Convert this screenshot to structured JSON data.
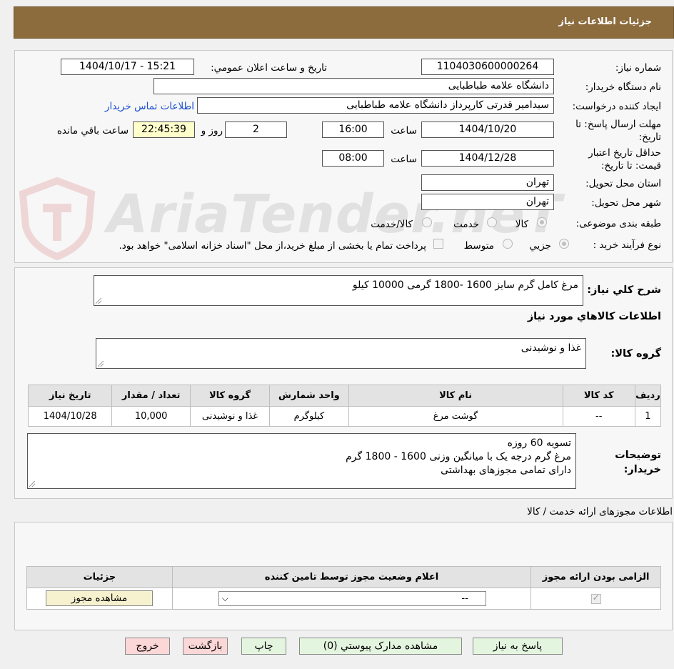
{
  "header": {
    "title": "جزئیات اطلاعات نیاز"
  },
  "form": {
    "need_number_label": "شماره نیاز:",
    "need_number": "1104030600000264",
    "announce_label": "تاریخ و ساعت اعلان عمومي:",
    "announce_value": "1404/10/17 - 15:21",
    "buyer_org_label": "نام دستگاه خريدار:",
    "buyer_org": "دانشگاه علامه طباطبایی",
    "requester_label": "ايجاد کننده درخواست:",
    "requester": "سیدامیر قدرتی کارپرداز دانشگاه علامه طباطبایی",
    "contact_link": "اطلاعات تماس خريدار",
    "deadline_label": "مهلت ارسال پاسخ: تا تاریخ:",
    "deadline_date": "1404/10/20",
    "time_label": "ساعت",
    "deadline_time": "16:00",
    "days_value": "2",
    "days_suffix": "روز و",
    "remaining_time": "22:45:39",
    "remaining_label": "ساعت باقي مانده",
    "price_validity_label": "حداقل تاريخ اعتبار قيمت: تا تاريخ:",
    "price_validity_date": "1404/12/28",
    "price_validity_time": "08:00",
    "province_label": "استان محل تحويل:",
    "province": "تهران",
    "city_label": "شهر محل تحويل:",
    "city": "تهران",
    "category_label": "طبقه بندی موضوعی:",
    "category_options": [
      "کالا",
      "خدمت",
      "کالا/خدمت"
    ],
    "process_label": "نوع فرآيند خريد :",
    "process_options": [
      "جزيي",
      "متوسط"
    ],
    "payment_note": "پرداخت تمام يا بخشی از مبلغ خريد،از محل \"اسناد خزانه اسلامی\" خواهد بود."
  },
  "summary": {
    "label": "شرح کلي نياز:",
    "text": "مرغ کامل گرم سایز 1600 -1800 گرمی 10000 کیلو",
    "goods_info_title": "اطلاعات کالاهاي مورد نياز",
    "goods_group_label": "گروه کالا:",
    "goods_group": "غذا و نوشیدنی"
  },
  "items_table": {
    "headers": [
      "رديف",
      "کد کالا",
      "نام کالا",
      "واحد شمارش",
      "گروه کالا",
      "تعداد / مقدار",
      "تاريخ نياز"
    ],
    "rows": [
      [
        "1",
        "--",
        "گوشت مرغ",
        "کیلوگرم",
        "غذا و نوشیدنی",
        "10,000",
        "1404/10/28"
      ]
    ]
  },
  "buyer_notes": {
    "label": "توضيحات خريدار:",
    "lines": [
      "تسویه 60 روزه",
      "مرغ گرم درجه یک با میانگین وزنی 1600 - 1800 گرم",
      "دارای تمامی مجوزهای بهداشتی"
    ]
  },
  "permits": {
    "section_title": "اطلاعات مجوزهای ارائه خدمت / کالا",
    "headers": [
      "الزامی بودن ارائه مجوز",
      "اعلام وضعيت مجوز توسط تامين کننده",
      "جزئيات"
    ],
    "select_value": "--",
    "view_button": "مشاهده مجوز"
  },
  "buttons": {
    "reply": "پاسخ به نياز",
    "attachments": "مشاهده مدارک پيوستي (0)",
    "print": "چاپ",
    "back": "بازگشت",
    "exit": "خروج"
  }
}
